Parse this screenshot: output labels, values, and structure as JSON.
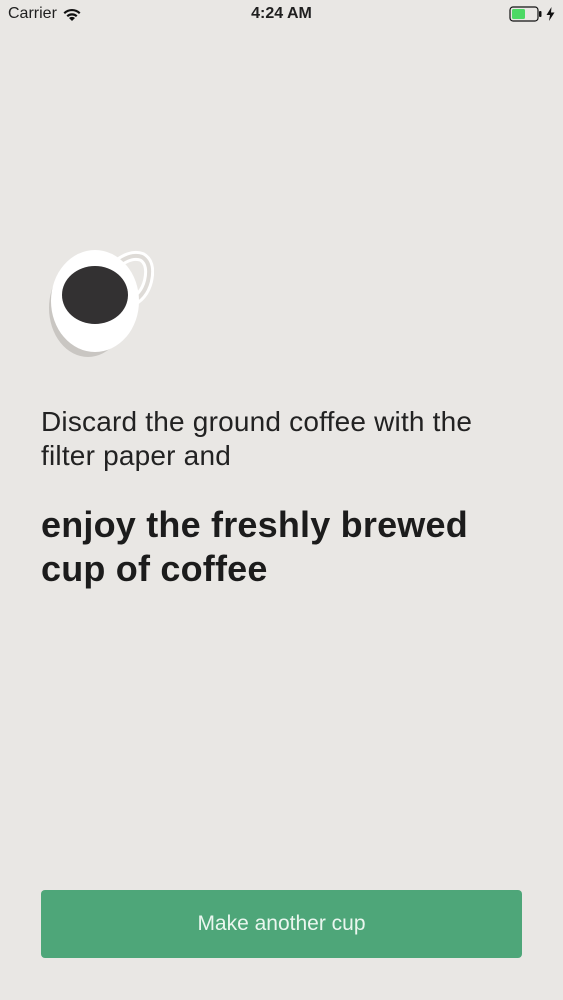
{
  "status_bar": {
    "carrier": "Carrier",
    "time": "4:24 AM"
  },
  "content": {
    "instruction": "Discard the ground coffee with the filter paper and",
    "emphasis": "enjoy the freshly brewed cup of coffee"
  },
  "actions": {
    "primary_label": "Make another cup"
  },
  "colors": {
    "background": "#e9e7e4",
    "button": "#4ea679",
    "battery": "#4cd964"
  },
  "icons": [
    "wifi-icon",
    "battery-icon",
    "charging-bolt-icon",
    "coffee-cup-icon"
  ]
}
